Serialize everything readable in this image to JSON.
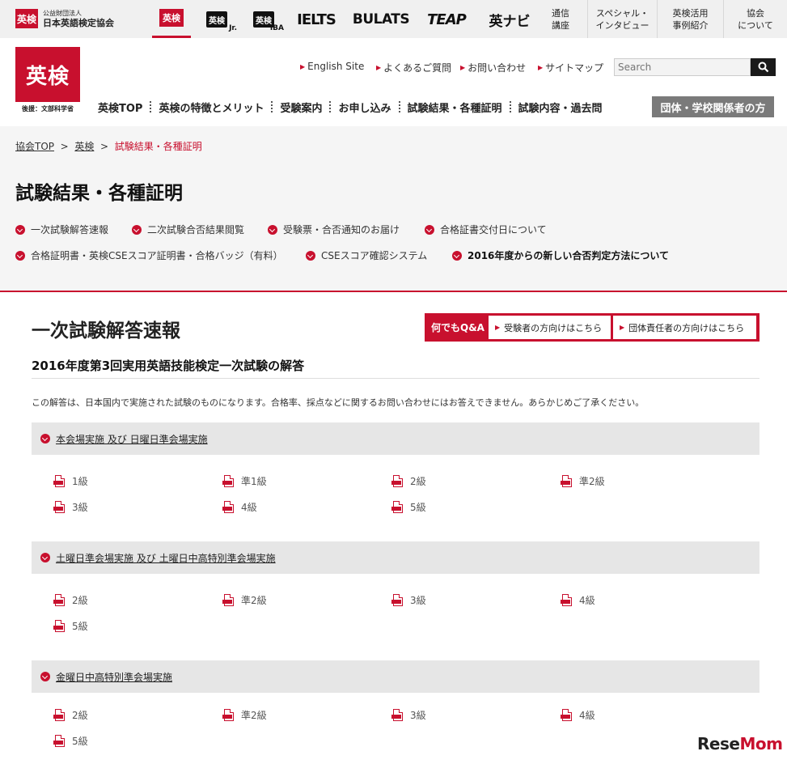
{
  "topbar": {
    "org_badge": "英検",
    "org_small": "公益財団法人",
    "org_name": "日本英語検定協会",
    "brands": {
      "eiken": "英検",
      "jr": "英検",
      "jr_sub": "Jr.",
      "iba": "英検",
      "iba_sub": "IBA",
      "ielts": "IELTS",
      "bulats": "BULATS",
      "teap": "TEAP",
      "navi": "英ナビ"
    },
    "links": [
      "通信\n講座",
      "スペシャル・\nインタビュー",
      "英検活用\n事例紹介",
      "協会\nについて"
    ]
  },
  "header": {
    "logo": "英検",
    "logo_sub": "後援：文部科学省",
    "util_links": [
      "English Site",
      "よくあるご質問",
      "お問い合わせ",
      "サイトマップ"
    ],
    "search_placeholder": "Search",
    "nav": [
      "英検TOP",
      "英検の特徴とメリット",
      "受験案内",
      "お申し込み",
      "試験結果・各種証明",
      "試験内容・過去問"
    ],
    "nav_special": "団体・学校関係者の方"
  },
  "breadcrumb": {
    "home": "協会TOP",
    "section": "英検",
    "current": "試験結果・各種証明"
  },
  "page_title": "試験結果・各種証明",
  "anchors": [
    "一次試験解答速報",
    "二次試験合否結果閲覧",
    "受験票・合否通知のお届け",
    "合格証書交付日について",
    "合格証明書・英検CSEスコア証明書・合格バッジ（有料）",
    "CSEスコア確認システム",
    "2016年度からの新しい合否判定方法について"
  ],
  "section": {
    "title": "一次試験解答速報",
    "qa_label": "何でもQ&A",
    "qa_buttons": [
      "受験者の方向けはこちら",
      "団体責任者の方向けはこちら"
    ],
    "subtitle": "2016年度第3回実用英語技能検定一次試験の解答",
    "note": "この解答は、日本国内で実施された試験のものになります。合格率、採点などに関するお問い合わせにはお答えできません。あらかじめご了承ください。"
  },
  "groups": [
    {
      "title": "本会場実施 及び 日曜日準会場実施",
      "grades": [
        "1級",
        "準1級",
        "2級",
        "準2級",
        "3級",
        "4級",
        "5級"
      ]
    },
    {
      "title": "土曜日準会場実施 及び 土曜日中高特別準会場実施",
      "grades": [
        "2級",
        "準2級",
        "3級",
        "4級",
        "5級"
      ]
    },
    {
      "title": "金曜日中高特別準会場実施",
      "grades": [
        "2級",
        "準2級",
        "3級",
        "4級",
        "5級"
      ]
    }
  ],
  "watermark": {
    "a": "Rese",
    "b": "Mom"
  },
  "colors": {
    "accent": "#c8102e",
    "band": "#e6e6e6",
    "nav_special": "#7a7a7a"
  }
}
